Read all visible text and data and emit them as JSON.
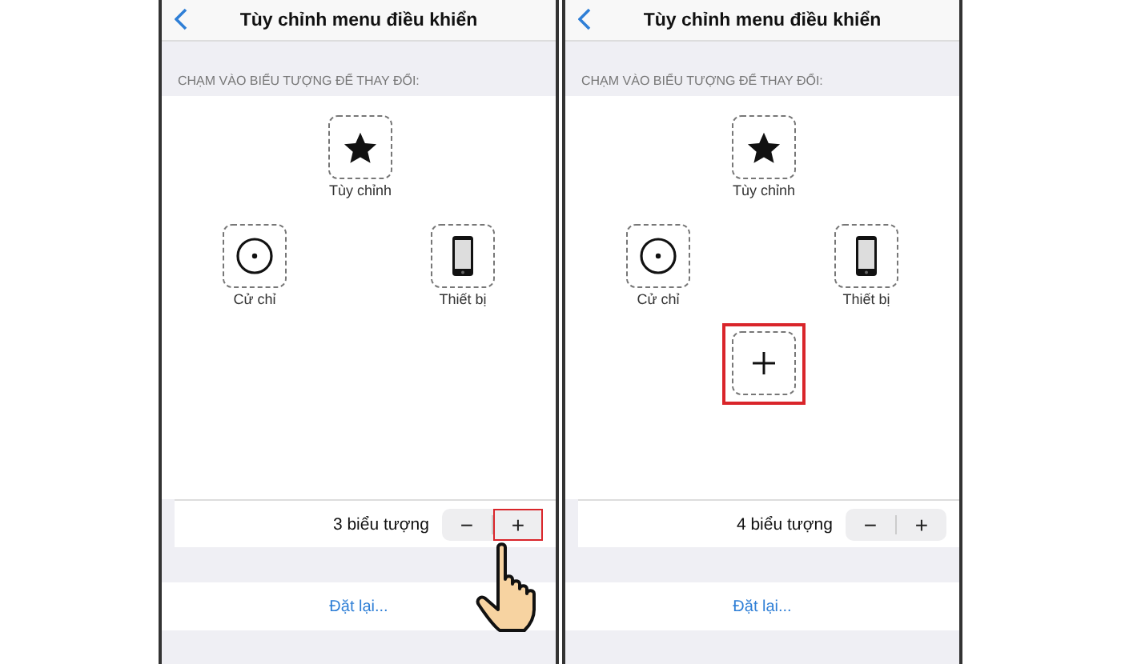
{
  "screens": [
    {
      "title": "Tùy chỉnh menu điều khiển",
      "section_header": "CHẠM VÀO BIỂU TƯỢNG ĐỂ THAY ĐỔI:",
      "slots": [
        {
          "label": "Tùy chỉnh",
          "kind": "star",
          "highlighted": false
        },
        {
          "label": "Cử chỉ",
          "kind": "circle",
          "highlighted": false
        },
        {
          "label": "Thiết bị",
          "kind": "phone",
          "highlighted": false
        }
      ],
      "count_text": "3 biểu tượng",
      "minus": "−",
      "plus": "+",
      "plus_highlighted": true,
      "show_cursor": true,
      "reset_label": "Đặt lại..."
    },
    {
      "title": "Tùy chỉnh menu điều khiển",
      "section_header": "CHẠM VÀO BIỂU TƯỢNG ĐỂ THAY ĐỔI:",
      "slots": [
        {
          "label": "Tùy chỉnh",
          "kind": "star",
          "highlighted": false
        },
        {
          "label": "Cử chỉ",
          "kind": "circle",
          "highlighted": false
        },
        {
          "label": "Thiết bị",
          "kind": "phone",
          "highlighted": false
        },
        {
          "kind": "add",
          "highlighted": true
        }
      ],
      "count_text": "4 biểu tượng",
      "minus": "−",
      "plus": "+",
      "plus_highlighted": false,
      "show_cursor": false,
      "reset_label": "Đặt lại..."
    }
  ]
}
